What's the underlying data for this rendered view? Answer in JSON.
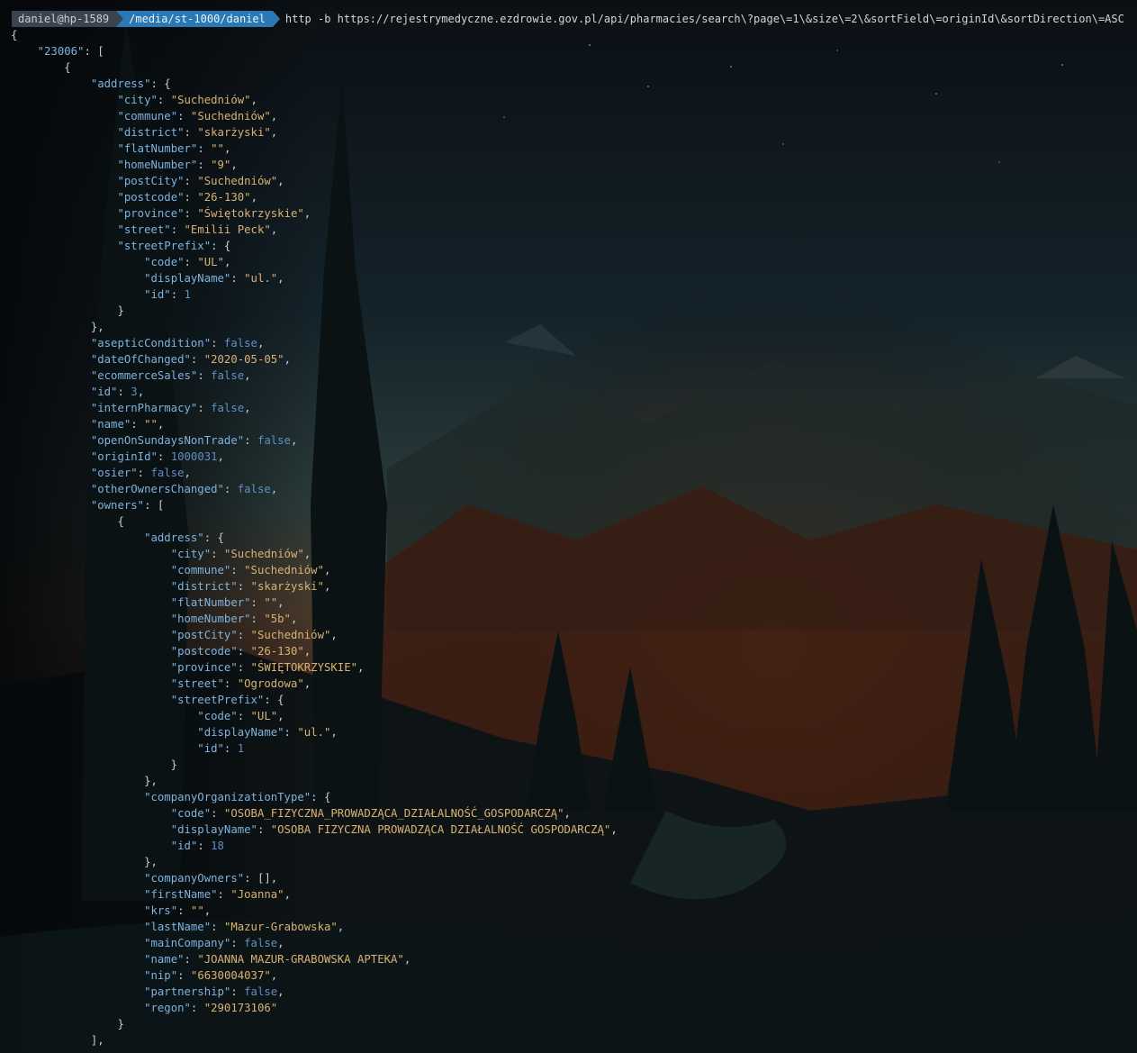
{
  "prompt": {
    "user": "daniel@hp-1589",
    "path": "/media/st-1000/daniel",
    "command": "http -b https://rejestrymedyczne.ezdrowie.gov.pl/api/pharmacies/search\\?page\\=1\\&size\\=2\\&sortField\\=originId\\&sortDirection\\=ASC"
  },
  "colors": {
    "key": "#7eb3df",
    "string": "#d9b273",
    "literal": "#5f8fc4",
    "punctuation": "#c9cdd2",
    "user_segment": "#3a4350",
    "path_segment": "#2a79b5"
  },
  "output_lines": [
    [
      [
        "p",
        "{"
      ]
    ],
    [
      [
        "p",
        "    "
      ],
      [
        "k",
        "\"23006\""
      ],
      [
        "p",
        ": ["
      ]
    ],
    [
      [
        "p",
        "        {"
      ]
    ],
    [
      [
        "p",
        "            "
      ],
      [
        "k",
        "\"address\""
      ],
      [
        "p",
        ": {"
      ]
    ],
    [
      [
        "p",
        "                "
      ],
      [
        "k",
        "\"city\""
      ],
      [
        "p",
        ": "
      ],
      [
        "s",
        "\"Suchedniów\""
      ],
      [
        "p",
        ","
      ]
    ],
    [
      [
        "p",
        "                "
      ],
      [
        "k",
        "\"commune\""
      ],
      [
        "p",
        ": "
      ],
      [
        "s",
        "\"Suchedniów\""
      ],
      [
        "p",
        ","
      ]
    ],
    [
      [
        "p",
        "                "
      ],
      [
        "k",
        "\"district\""
      ],
      [
        "p",
        ": "
      ],
      [
        "s",
        "\"skarżyski\""
      ],
      [
        "p",
        ","
      ]
    ],
    [
      [
        "p",
        "                "
      ],
      [
        "k",
        "\"flatNumber\""
      ],
      [
        "p",
        ": "
      ],
      [
        "s",
        "\"\""
      ],
      [
        "p",
        ","
      ]
    ],
    [
      [
        "p",
        "                "
      ],
      [
        "k",
        "\"homeNumber\""
      ],
      [
        "p",
        ": "
      ],
      [
        "s",
        "\"9\""
      ],
      [
        "p",
        ","
      ]
    ],
    [
      [
        "p",
        "                "
      ],
      [
        "k",
        "\"postCity\""
      ],
      [
        "p",
        ": "
      ],
      [
        "s",
        "\"Suchedniów\""
      ],
      [
        "p",
        ","
      ]
    ],
    [
      [
        "p",
        "                "
      ],
      [
        "k",
        "\"postcode\""
      ],
      [
        "p",
        ": "
      ],
      [
        "s",
        "\"26-130\""
      ],
      [
        "p",
        ","
      ]
    ],
    [
      [
        "p",
        "                "
      ],
      [
        "k",
        "\"province\""
      ],
      [
        "p",
        ": "
      ],
      [
        "s",
        "\"Świętokrzyskie\""
      ],
      [
        "p",
        ","
      ]
    ],
    [
      [
        "p",
        "                "
      ],
      [
        "k",
        "\"street\""
      ],
      [
        "p",
        ": "
      ],
      [
        "s",
        "\"Emilii Peck\""
      ],
      [
        "p",
        ","
      ]
    ],
    [
      [
        "p",
        "                "
      ],
      [
        "k",
        "\"streetPrefix\""
      ],
      [
        "p",
        ": {"
      ]
    ],
    [
      [
        "p",
        "                    "
      ],
      [
        "k",
        "\"code\""
      ],
      [
        "p",
        ": "
      ],
      [
        "s",
        "\"UL\""
      ],
      [
        "p",
        ","
      ]
    ],
    [
      [
        "p",
        "                    "
      ],
      [
        "k",
        "\"displayName\""
      ],
      [
        "p",
        ": "
      ],
      [
        "s",
        "\"ul.\""
      ],
      [
        "p",
        ","
      ]
    ],
    [
      [
        "p",
        "                    "
      ],
      [
        "k",
        "\"id\""
      ],
      [
        "p",
        ": "
      ],
      [
        "n",
        "1"
      ]
    ],
    [
      [
        "p",
        "                }"
      ]
    ],
    [
      [
        "p",
        "            },"
      ]
    ],
    [
      [
        "p",
        "            "
      ],
      [
        "k",
        "\"asepticCondition\""
      ],
      [
        "p",
        ": "
      ],
      [
        "b",
        "false"
      ],
      [
        "p",
        ","
      ]
    ],
    [
      [
        "p",
        "            "
      ],
      [
        "k",
        "\"dateOfChanged\""
      ],
      [
        "p",
        ": "
      ],
      [
        "s",
        "\"2020-05-05\""
      ],
      [
        "p",
        ","
      ]
    ],
    [
      [
        "p",
        "            "
      ],
      [
        "k",
        "\"ecommerceSales\""
      ],
      [
        "p",
        ": "
      ],
      [
        "b",
        "false"
      ],
      [
        "p",
        ","
      ]
    ],
    [
      [
        "p",
        "            "
      ],
      [
        "k",
        "\"id\""
      ],
      [
        "p",
        ": "
      ],
      [
        "n",
        "3"
      ],
      [
        "p",
        ","
      ]
    ],
    [
      [
        "p",
        "            "
      ],
      [
        "k",
        "\"internPharmacy\""
      ],
      [
        "p",
        ": "
      ],
      [
        "b",
        "false"
      ],
      [
        "p",
        ","
      ]
    ],
    [
      [
        "p",
        "            "
      ],
      [
        "k",
        "\"name\""
      ],
      [
        "p",
        ": "
      ],
      [
        "s",
        "\"\""
      ],
      [
        "p",
        ","
      ]
    ],
    [
      [
        "p",
        "            "
      ],
      [
        "k",
        "\"openOnSundaysNonTrade\""
      ],
      [
        "p",
        ": "
      ],
      [
        "b",
        "false"
      ],
      [
        "p",
        ","
      ]
    ],
    [
      [
        "p",
        "            "
      ],
      [
        "k",
        "\"originId\""
      ],
      [
        "p",
        ": "
      ],
      [
        "n",
        "1000031"
      ],
      [
        "p",
        ","
      ]
    ],
    [
      [
        "p",
        "            "
      ],
      [
        "k",
        "\"osier\""
      ],
      [
        "p",
        ": "
      ],
      [
        "b",
        "false"
      ],
      [
        "p",
        ","
      ]
    ],
    [
      [
        "p",
        "            "
      ],
      [
        "k",
        "\"otherOwnersChanged\""
      ],
      [
        "p",
        ": "
      ],
      [
        "b",
        "false"
      ],
      [
        "p",
        ","
      ]
    ],
    [
      [
        "p",
        "            "
      ],
      [
        "k",
        "\"owners\""
      ],
      [
        "p",
        ": ["
      ]
    ],
    [
      [
        "p",
        "                {"
      ]
    ],
    [
      [
        "p",
        "                    "
      ],
      [
        "k",
        "\"address\""
      ],
      [
        "p",
        ": {"
      ]
    ],
    [
      [
        "p",
        "                        "
      ],
      [
        "k",
        "\"city\""
      ],
      [
        "p",
        ": "
      ],
      [
        "s",
        "\"Suchedniów\""
      ],
      [
        "p",
        ","
      ]
    ],
    [
      [
        "p",
        "                        "
      ],
      [
        "k",
        "\"commune\""
      ],
      [
        "p",
        ": "
      ],
      [
        "s",
        "\"Suchedniów\""
      ],
      [
        "p",
        ","
      ]
    ],
    [
      [
        "p",
        "                        "
      ],
      [
        "k",
        "\"district\""
      ],
      [
        "p",
        ": "
      ],
      [
        "s",
        "\"skarżyski\""
      ],
      [
        "p",
        ","
      ]
    ],
    [
      [
        "p",
        "                        "
      ],
      [
        "k",
        "\"flatNumber\""
      ],
      [
        "p",
        ": "
      ],
      [
        "s",
        "\"\""
      ],
      [
        "p",
        ","
      ]
    ],
    [
      [
        "p",
        "                        "
      ],
      [
        "k",
        "\"homeNumber\""
      ],
      [
        "p",
        ": "
      ],
      [
        "s",
        "\"5b\""
      ],
      [
        "p",
        ","
      ]
    ],
    [
      [
        "p",
        "                        "
      ],
      [
        "k",
        "\"postCity\""
      ],
      [
        "p",
        ": "
      ],
      [
        "s",
        "\"Suchedniów\""
      ],
      [
        "p",
        ","
      ]
    ],
    [
      [
        "p",
        "                        "
      ],
      [
        "k",
        "\"postcode\""
      ],
      [
        "p",
        ": "
      ],
      [
        "s",
        "\"26-130\""
      ],
      [
        "p",
        ","
      ]
    ],
    [
      [
        "p",
        "                        "
      ],
      [
        "k",
        "\"province\""
      ],
      [
        "p",
        ": "
      ],
      [
        "s",
        "\"ŚWIĘTOKRZYSKIE\""
      ],
      [
        "p",
        ","
      ]
    ],
    [
      [
        "p",
        "                        "
      ],
      [
        "k",
        "\"street\""
      ],
      [
        "p",
        ": "
      ],
      [
        "s",
        "\"Ogrodowa\""
      ],
      [
        "p",
        ","
      ]
    ],
    [
      [
        "p",
        "                        "
      ],
      [
        "k",
        "\"streetPrefix\""
      ],
      [
        "p",
        ": {"
      ]
    ],
    [
      [
        "p",
        "                            "
      ],
      [
        "k",
        "\"code\""
      ],
      [
        "p",
        ": "
      ],
      [
        "s",
        "\"UL\""
      ],
      [
        "p",
        ","
      ]
    ],
    [
      [
        "p",
        "                            "
      ],
      [
        "k",
        "\"displayName\""
      ],
      [
        "p",
        ": "
      ],
      [
        "s",
        "\"ul.\""
      ],
      [
        "p",
        ","
      ]
    ],
    [
      [
        "p",
        "                            "
      ],
      [
        "k",
        "\"id\""
      ],
      [
        "p",
        ": "
      ],
      [
        "n",
        "1"
      ]
    ],
    [
      [
        "p",
        "                        }"
      ]
    ],
    [
      [
        "p",
        "                    },"
      ]
    ],
    [
      [
        "p",
        "                    "
      ],
      [
        "k",
        "\"companyOrganizationType\""
      ],
      [
        "p",
        ": {"
      ]
    ],
    [
      [
        "p",
        "                        "
      ],
      [
        "k",
        "\"code\""
      ],
      [
        "p",
        ": "
      ],
      [
        "s",
        "\"OSOBA_FIZYCZNA_PROWADZĄCA_DZIAŁALNOŚĆ_GOSPODARCZĄ\""
      ],
      [
        "p",
        ","
      ]
    ],
    [
      [
        "p",
        "                        "
      ],
      [
        "k",
        "\"displayName\""
      ],
      [
        "p",
        ": "
      ],
      [
        "s",
        "\"OSOBA FIZYCZNA PROWADZĄCA DZIAŁALNOŚĆ GOSPODARCZĄ\""
      ],
      [
        "p",
        ","
      ]
    ],
    [
      [
        "p",
        "                        "
      ],
      [
        "k",
        "\"id\""
      ],
      [
        "p",
        ": "
      ],
      [
        "n",
        "18"
      ]
    ],
    [
      [
        "p",
        "                    },"
      ]
    ],
    [
      [
        "p",
        "                    "
      ],
      [
        "k",
        "\"companyOwners\""
      ],
      [
        "p",
        ": [],"
      ]
    ],
    [
      [
        "p",
        "                    "
      ],
      [
        "k",
        "\"firstName\""
      ],
      [
        "p",
        ": "
      ],
      [
        "s",
        "\"Joanna\""
      ],
      [
        "p",
        ","
      ]
    ],
    [
      [
        "p",
        "                    "
      ],
      [
        "k",
        "\"krs\""
      ],
      [
        "p",
        ": "
      ],
      [
        "s",
        "\"\""
      ],
      [
        "p",
        ","
      ]
    ],
    [
      [
        "p",
        "                    "
      ],
      [
        "k",
        "\"lastName\""
      ],
      [
        "p",
        ": "
      ],
      [
        "s",
        "\"Mazur-Grabowska\""
      ],
      [
        "p",
        ","
      ]
    ],
    [
      [
        "p",
        "                    "
      ],
      [
        "k",
        "\"mainCompany\""
      ],
      [
        "p",
        ": "
      ],
      [
        "b",
        "false"
      ],
      [
        "p",
        ","
      ]
    ],
    [
      [
        "p",
        "                    "
      ],
      [
        "k",
        "\"name\""
      ],
      [
        "p",
        ": "
      ],
      [
        "s",
        "\"JOANNA MAZUR-GRABOWSKA APTEKA\""
      ],
      [
        "p",
        ","
      ]
    ],
    [
      [
        "p",
        "                    "
      ],
      [
        "k",
        "\"nip\""
      ],
      [
        "p",
        ": "
      ],
      [
        "s",
        "\"6630004037\""
      ],
      [
        "p",
        ","
      ]
    ],
    [
      [
        "p",
        "                    "
      ],
      [
        "k",
        "\"partnership\""
      ],
      [
        "p",
        ": "
      ],
      [
        "b",
        "false"
      ],
      [
        "p",
        ","
      ]
    ],
    [
      [
        "p",
        "                    "
      ],
      [
        "k",
        "\"regon\""
      ],
      [
        "p",
        ": "
      ],
      [
        "s",
        "\"290173106\""
      ]
    ],
    [
      [
        "p",
        "                }"
      ]
    ],
    [
      [
        "p",
        "            ],"
      ]
    ]
  ]
}
